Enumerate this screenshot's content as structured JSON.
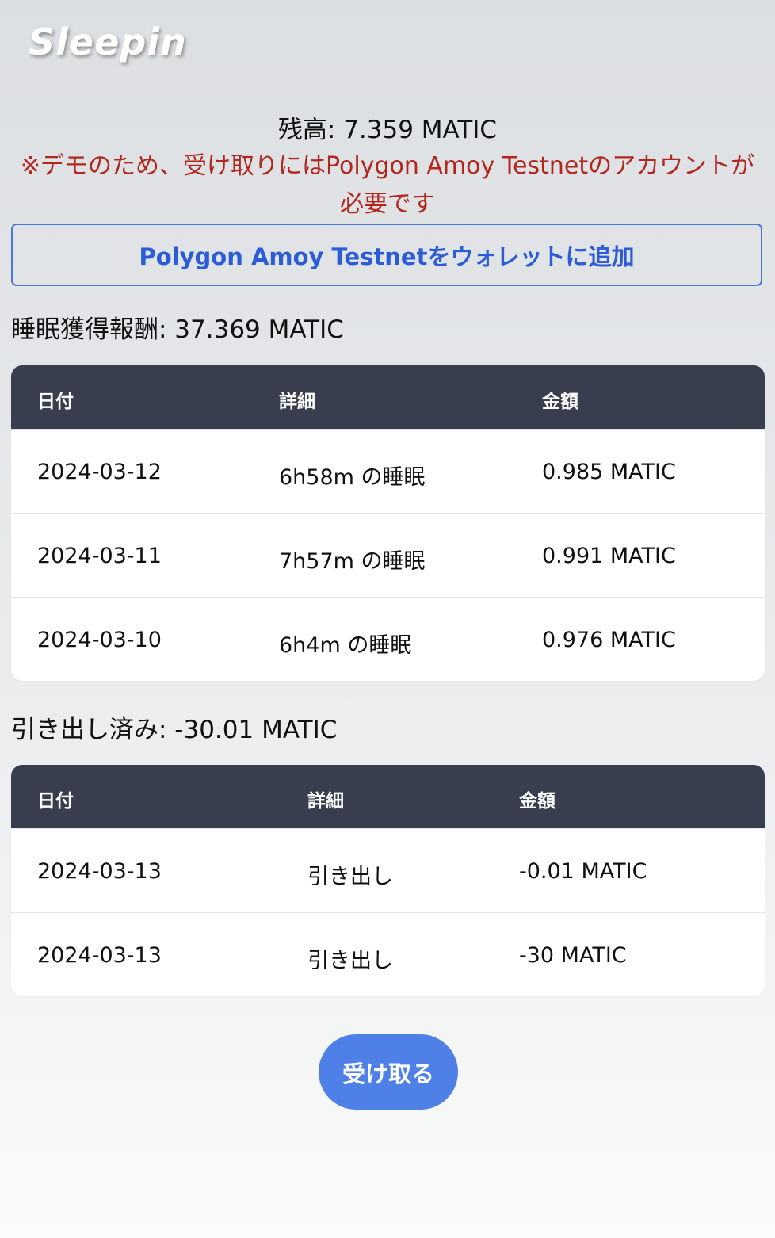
{
  "app": {
    "title": "Sleepin"
  },
  "balance": {
    "text": "残高: 7.359 MATIC"
  },
  "notice": {
    "text": "※デモのため、受け取りにはPolygon Amoy Testnetのアカウントが必要です"
  },
  "add_network_button": {
    "label": "Polygon Amoy Testnetをウォレットに追加"
  },
  "sleep_rewards": {
    "label": "睡眠獲得報酬: 37.369 MATIC",
    "headers": {
      "date": "日付",
      "detail": "詳細",
      "amount": "金額"
    },
    "rows": [
      {
        "date": "2024-03-12",
        "detail": "6h58m の睡眠",
        "amount": "0.985 MATIC"
      },
      {
        "date": "2024-03-11",
        "detail": "7h57m の睡眠",
        "amount": "0.991 MATIC"
      },
      {
        "date": "2024-03-10",
        "detail": "6h4m の睡眠",
        "amount": "0.976 MATIC"
      }
    ]
  },
  "withdrawals": {
    "label": "引き出し済み: -30.01 MATIC",
    "headers": {
      "date": "日付",
      "detail": "詳細",
      "amount": "金額"
    },
    "rows": [
      {
        "date": "2024-03-13",
        "detail": "引き出し",
        "amount": "-0.01 MATIC"
      },
      {
        "date": "2024-03-13",
        "detail": "引き出し",
        "amount": "-30 MATIC"
      }
    ]
  },
  "claim_button": {
    "label": "受け取る"
  },
  "colors": {
    "accent": "#4f80e8",
    "link_blue": "#2b5bd7",
    "warning_red": "#b3261e",
    "table_header": "#383e4d"
  }
}
